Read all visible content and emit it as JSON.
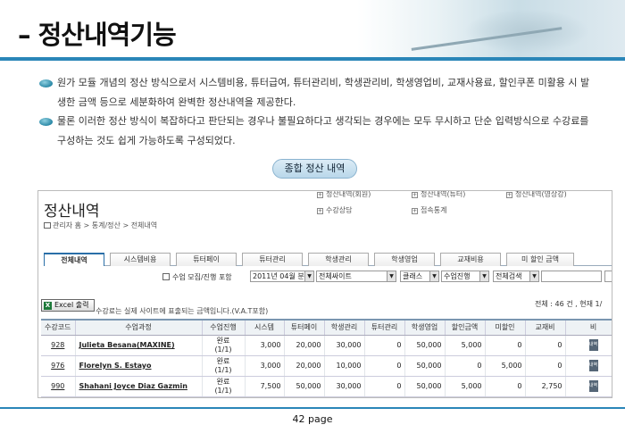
{
  "slide": {
    "title": "– 정산내역기능",
    "bullets": [
      "원가 모듈 개념의 정산 방식으로서 시스템비용, 튜터급여, 튜터관리비, 학생관리비, 학생영업비, 교재사용료, 할인쿠폰 미활용 시 발생한 금액 등으로 세분화하여 완벽한 정산내역을 제공한다.",
      "물론 이러한 정산 방식이 복잡하다고 판단되는 경우나 불필요하다고 생각되는 경우에는 모두 무시하고 단순 입력방식으로 수강료를 구성하는 것도 쉽게 가능하도록 구성되었다."
    ],
    "summary_button": "종합 정산 내역",
    "page_label": "42 page"
  },
  "screen": {
    "title": "정산내역",
    "breadcrumb": "관리자 홈 > 통계/정산 > 전체내역",
    "quick_links": [
      "정산내역(회원)",
      "정산내역(튜터)",
      "정산내역(영상강)",
      "수강상담",
      "접속통계"
    ],
    "tabs": [
      "전체내역",
      "시스템비용",
      "튜터페이",
      "튜터관리",
      "학생관리",
      "학생영업",
      "교재비용",
      "미 할인 금액"
    ],
    "active_tab": 0,
    "filters": {
      "checkbox_label": "수업 모집/진행 포함",
      "month": "2011년 04월 분",
      "site": "전체싸이트",
      "class": "클래스",
      "progress": "수업진행",
      "search_type": "전체검색"
    },
    "excel_button": "Excel 출력",
    "note": "수강료는 실제 사이트에 표출되는 금액입니다.(V.A.T포함)",
    "count_text": "전체 : 46 건 , 현재 1/",
    "columns": [
      "수강코드",
      "수업과정",
      "수업진행",
      "시스템",
      "튜터페이",
      "학생관리",
      "튜터관리",
      "학생영업",
      "할인금액",
      "미할인",
      "교재비",
      "비"
    ],
    "rows": [
      {
        "code": "928",
        "course": "Julieta Besana(MAXINE)",
        "status": "완료",
        "status_sub": "(1/1)",
        "system": "3,000",
        "tutor_pay": "20,000",
        "student_mgmt": "30,000",
        "tutor_mgmt": "0",
        "student_sales": "50,000",
        "discount": "5,000",
        "no_discount": "0",
        "textbook": "0",
        "btn": "내역"
      },
      {
        "code": "976",
        "course": "Florelyn S. Estayo",
        "status": "완료",
        "status_sub": "(1/1)",
        "system": "3,000",
        "tutor_pay": "20,000",
        "student_mgmt": "10,000",
        "tutor_mgmt": "0",
        "student_sales": "50,000",
        "discount": "0",
        "no_discount": "5,000",
        "textbook": "0",
        "btn": "내역"
      },
      {
        "code": "990",
        "course": "Shahani Joyce Diaz Gazmin",
        "status": "완료",
        "status_sub": "(1/1)",
        "system": "7,500",
        "tutor_pay": "50,000",
        "student_mgmt": "30,000",
        "tutor_mgmt": "0",
        "student_sales": "50,000",
        "discount": "5,000",
        "no_discount": "0",
        "textbook": "2,750",
        "btn": "내역"
      }
    ]
  },
  "colors": {
    "accent": "#2a86b8",
    "tab_active": "#2a6fa8"
  }
}
